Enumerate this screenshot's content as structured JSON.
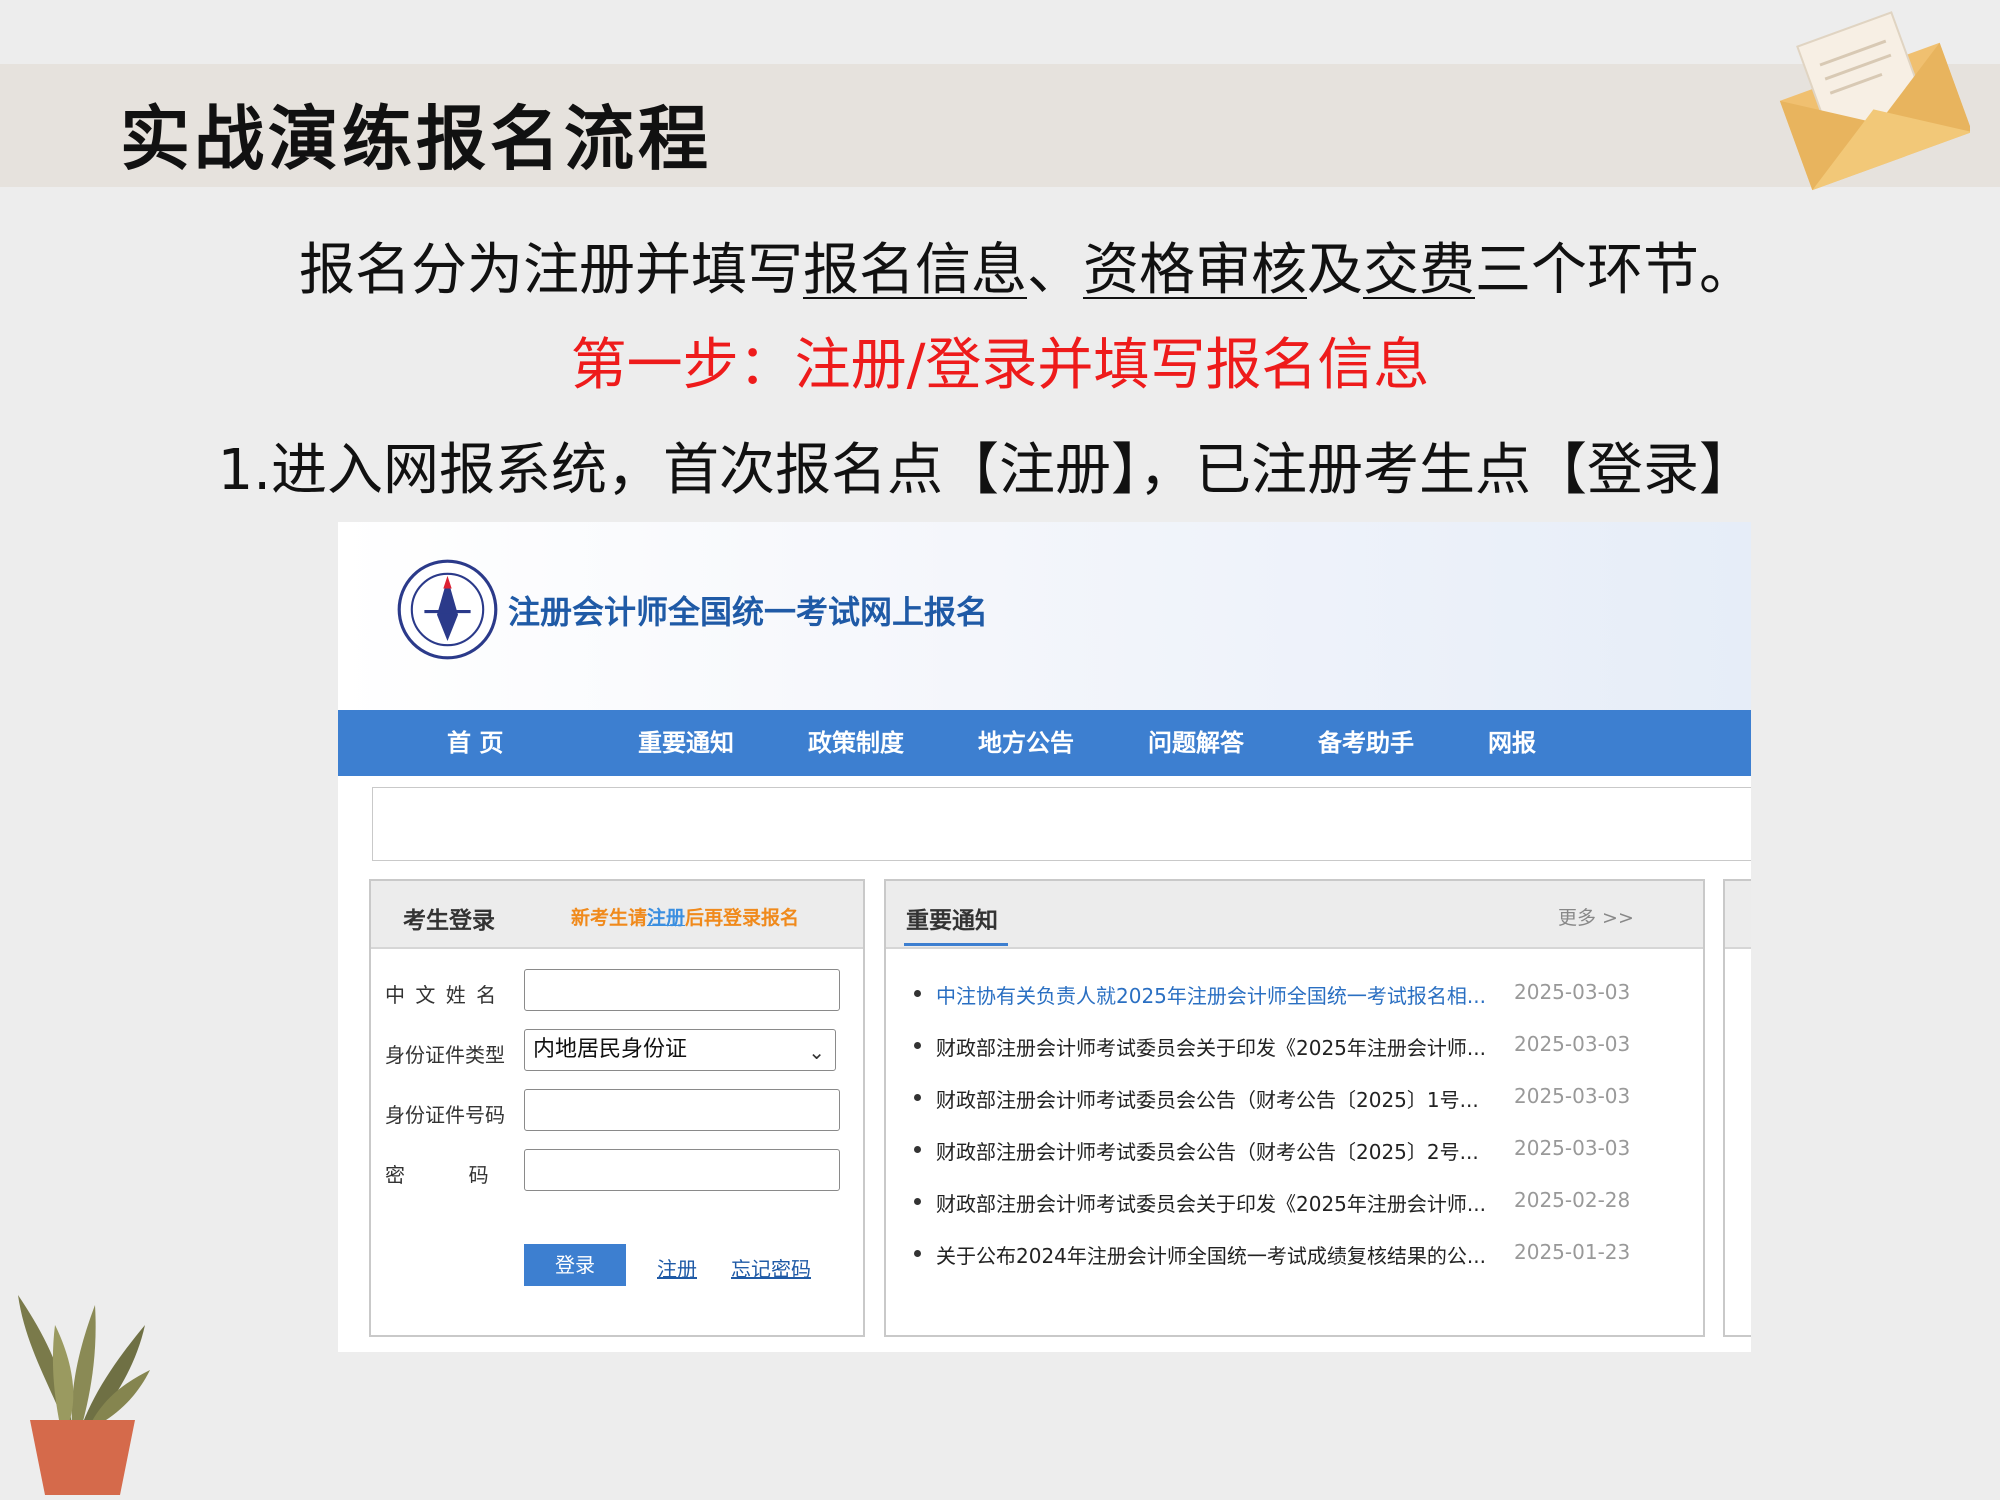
{
  "slide": {
    "title": "实战演练报名流程",
    "line1_parts": [
      "报名分为注册并填写",
      "报名信息",
      "、",
      "资格审核",
      "及",
      "交费",
      "三个环节。"
    ],
    "step_title": "第一步：注册/登录并填写报名信息",
    "instruction": "1.进入网报系统，首次报名点【注册】，已注册考生点【登录】"
  },
  "site": {
    "title": "注册会计师全国统一考试网上报名",
    "nav": [
      "首 页",
      "重要通知",
      "政策制度",
      "地方公告",
      "问题解答",
      "备考助手",
      "网报"
    ]
  },
  "login": {
    "title": "考生登录",
    "hint_pre": "新考生请",
    "hint_link": "注册",
    "hint_post": "后再登录报名",
    "name_label": "中 文  姓 名",
    "id_type_label": "身份证件类型",
    "id_type_value": "内地居民身份证",
    "id_number_label": "身份证件号码",
    "password_label": "密          码",
    "login_button": "登录",
    "register_link": "注册",
    "forgot_link": "忘记密码"
  },
  "notices": {
    "title": "重要通知",
    "more": "更多 >>",
    "items": [
      {
        "text": "中注协有关负责人就2025年注册会计师全国统一考试报名相...",
        "date": "2025-03-03"
      },
      {
        "text": "财政部注册会计师考试委员会关于印发《2025年注册会计师...",
        "date": "2025-03-03"
      },
      {
        "text": "财政部注册会计师考试委员会公告（财考公告〔2025〕1号...",
        "date": "2025-03-03"
      },
      {
        "text": "财政部注册会计师考试委员会公告（财考公告〔2025〕2号...",
        "date": "2025-03-03"
      },
      {
        "text": "财政部注册会计师考试委员会关于印发《2025年注册会计师...",
        "date": "2025-02-28"
      },
      {
        "text": "关于公布2024年注册会计师全国统一考试成绩复核结果的公...",
        "date": "2025-01-23"
      }
    ]
  },
  "colors": {
    "nav_blue": "#3d7fd0",
    "step_red": "#ee1b1b",
    "hint_orange": "#f08a1c",
    "link_blue": "#1f5aa6"
  },
  "icons": [
    "envelope-icon",
    "plant-icon",
    "cicpa-logo-icon",
    "chevron-down-icon"
  ]
}
